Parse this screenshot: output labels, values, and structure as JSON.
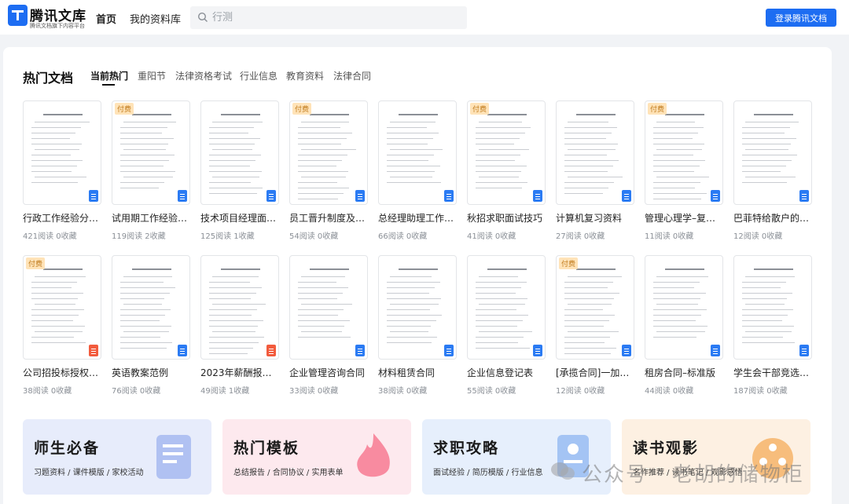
{
  "header": {
    "brand_title": "腾讯文库",
    "brand_sub": "腾讯文档旗下内容平台",
    "nav": [
      "首页",
      "我的资料库"
    ],
    "search_placeholder": "行测",
    "login_label": "登录腾讯文档"
  },
  "section": {
    "title": "热门文档",
    "tabs": [
      "当前热门",
      "重阳节",
      "法律资格考试",
      "行业信息",
      "教育资料",
      "法律合同"
    ]
  },
  "docs": [
    {
      "title": "行政工作经验分…",
      "meta": "421阅读 0收藏",
      "badge": "",
      "icon": "doc"
    },
    {
      "title": "试用期工作经验…",
      "meta": "119阅读 2收藏",
      "badge": "付费",
      "icon": "doc"
    },
    {
      "title": "技术项目经理面…",
      "meta": "125阅读 1收藏",
      "badge": "",
      "icon": "doc"
    },
    {
      "title": "员工晋升制度及…",
      "meta": "54阅读 0收藏",
      "badge": "付费",
      "icon": "doc"
    },
    {
      "title": "总经理助理工作…",
      "meta": "66阅读 0收藏",
      "badge": "",
      "icon": "doc"
    },
    {
      "title": "秋招求职面试技巧",
      "meta": "41阅读 0收藏",
      "badge": "付费",
      "icon": "doc"
    },
    {
      "title": "计算机复习资料",
      "meta": "27阅读 0收藏",
      "badge": "",
      "icon": "doc"
    },
    {
      "title": "管理心理学–复习…",
      "meta": "11阅读 0收藏",
      "badge": "付费",
      "icon": "doc"
    },
    {
      "title": "巴菲特给散户的9…",
      "meta": "12阅读 0收藏",
      "badge": "",
      "icon": "doc"
    },
    {
      "title": "公司招投标授权…",
      "meta": "38阅读 0收藏",
      "badge": "付费",
      "icon": "pdf"
    },
    {
      "title": "英语教案范例",
      "meta": "76阅读 0收藏",
      "badge": "",
      "icon": "doc"
    },
    {
      "title": "2023年薪酬报告…",
      "meta": "49阅读 1收藏",
      "badge": "",
      "icon": "pdf"
    },
    {
      "title": "企业管理咨询合同",
      "meta": "33阅读 0收藏",
      "badge": "",
      "icon": "doc"
    },
    {
      "title": "材料租赁合同",
      "meta": "38阅读 0收藏",
      "badge": "",
      "icon": "doc"
    },
    {
      "title": "企业信息登记表",
      "meta": "55阅读 0收藏",
      "badge": "",
      "icon": "doc"
    },
    {
      "title": "[承揽合同]一加…",
      "meta": "12阅读 0收藏",
      "badge": "付费",
      "icon": "doc"
    },
    {
      "title": "租房合同–标准版",
      "meta": "44阅读 0收藏",
      "badge": "",
      "icon": "doc"
    },
    {
      "title": "学生会干部竞选…",
      "meta": "187阅读 0收藏",
      "badge": "",
      "icon": "doc"
    }
  ],
  "categories": [
    {
      "title": "师生必备",
      "sub": "习题资料 / 课件模版 / 家校活动",
      "bg": "#e7ecfb",
      "accent": "#9db3ef"
    },
    {
      "title": "热门模板",
      "sub": "总结报告 / 合同协议 / 实用表单",
      "bg": "#fde9ee",
      "accent": "#f77a92"
    },
    {
      "title": "求职攻略",
      "sub": "面试经验 / 简历模版 / 行业信息",
      "bg": "#e6effc",
      "accent": "#8eb5f2"
    },
    {
      "title": "读书观影",
      "sub": "名作推荐 / 读书笔记 / 观影感悟",
      "bg": "#fdf0e2",
      "accent": "#f6b46a"
    }
  ],
  "watermark": "公众号 · 老胡的储物柜",
  "colors": {
    "primary": "#1d6df2",
    "paid_badge": "#ffe3b8"
  }
}
